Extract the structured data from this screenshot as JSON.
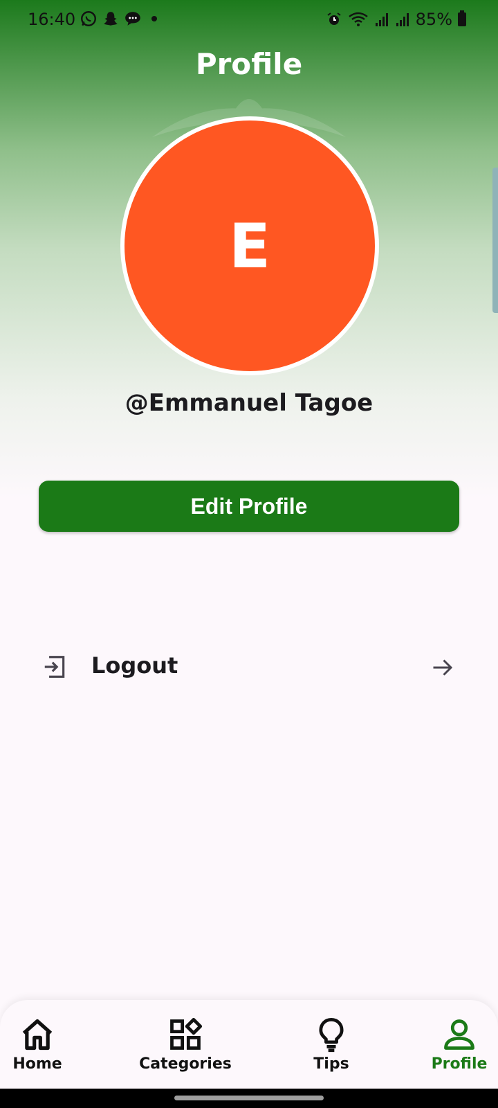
{
  "status_bar": {
    "time": "16:40",
    "battery": "85%",
    "left_icons": [
      "whatsapp-icon",
      "snapchat-icon",
      "message-icon"
    ],
    "right_icons": [
      "alarm-icon",
      "wifi-icon",
      "signal-icon",
      "signal-icon"
    ]
  },
  "header": {
    "title": "Profile"
  },
  "profile": {
    "avatar_letter": "E",
    "avatar_color": "#ff5722",
    "username": "@Emmanuel Tagoe"
  },
  "actions": {
    "edit_profile_label": "Edit Profile",
    "logout_label": "Logout"
  },
  "bottom_nav": {
    "items": [
      {
        "label": "Home",
        "icon": "home-icon"
      },
      {
        "label": "Categories",
        "icon": "categories-icon"
      },
      {
        "label": "Tips",
        "icon": "lightbulb-icon"
      },
      {
        "label": "Profile",
        "icon": "person-icon",
        "active": true
      }
    ]
  },
  "colors": {
    "brand_green": "#1b7a17",
    "avatar_orange": "#ff5722",
    "background": "#fdf8fc"
  }
}
